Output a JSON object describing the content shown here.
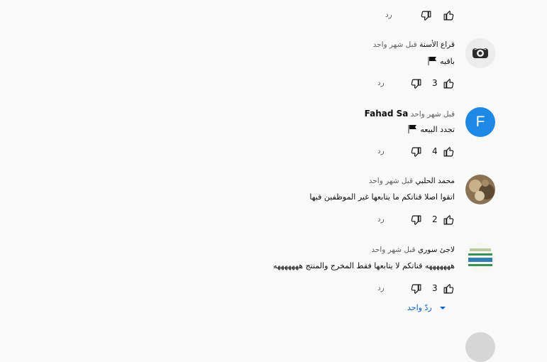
{
  "colors": {
    "background": "#f9f9f9",
    "text_primary": "#0f0f0f",
    "text_secondary": "#606060",
    "link_blue": "#065fd4",
    "avatar_blue": "#1e88e5"
  },
  "top_actions": {
    "reply_label": "رد"
  },
  "comments": [
    {
      "author": "قراع الأسنة",
      "time": "قبل شهر واحد",
      "text": "باقيه",
      "emoji": "black-flag",
      "likes": "",
      "reply_label": "رد",
      "avatar": "photo"
    },
    {
      "author": "قراع الأسنة",
      "time": "قبل شهر واحد",
      "text": "باقيه",
      "emoji": "black-flag",
      "likes": "3",
      "reply_label": "رد",
      "avatar": "seal"
    },
    {
      "author": "Fahad Sa",
      "time": "قبل شهر واحد",
      "text": "تجدد البيعه",
      "emoji": "black-flag",
      "likes": "4",
      "reply_label": "رد",
      "avatar_letter": "F"
    },
    {
      "author": "محمد الحلبي",
      "time": "قبل شهر واحد",
      "text": "اتقوا اصلا قناتكم ما يتابعها غير الموظفين فيها",
      "likes": "2",
      "reply_label": "رد",
      "avatar": "photo"
    },
    {
      "author": "لاجئ سوري",
      "time": "قبل شهر واحد",
      "text": "هههههههه قناتكم لا يتابعها فقط المخرج والمنتج هههههههه",
      "likes": "3",
      "reply_label": "رد",
      "avatar": "document"
    }
  ],
  "replies_toggle": {
    "label": "ردّ واحد",
    "icon": "caret-down-icon"
  }
}
